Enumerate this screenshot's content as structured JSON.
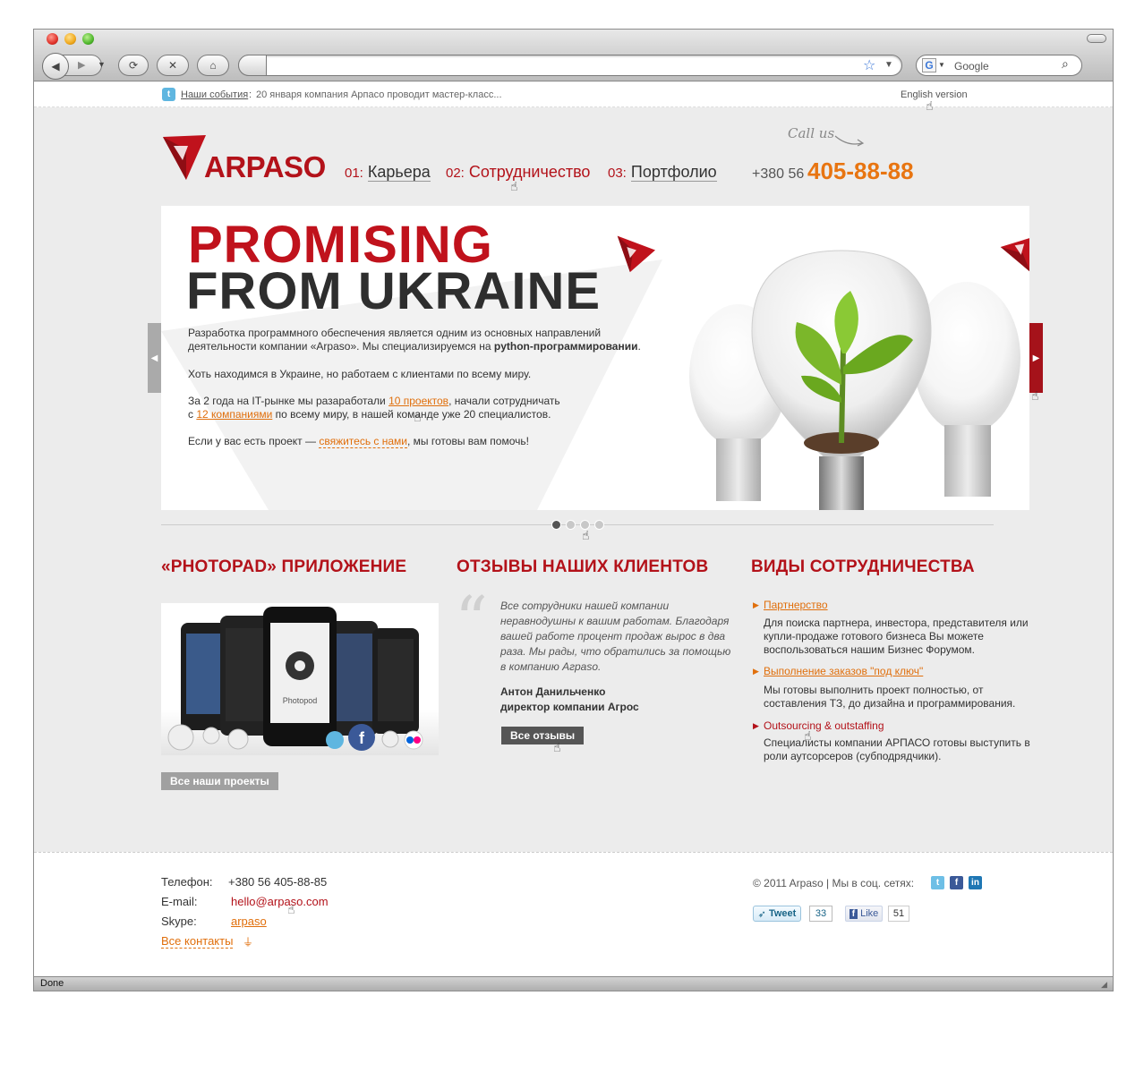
{
  "browser": {
    "search_placeholder": "Google",
    "status_text": "Done"
  },
  "topbar": {
    "news_label": "Наши события",
    "news_text": "20 января компания Арпасо проводит мастер-класс...",
    "english_link": "English version"
  },
  "header": {
    "logo_text": "ARPASO",
    "nav": [
      {
        "num": "01:",
        "label": "Карьера"
      },
      {
        "num": "02:",
        "label": "Сотрудничество"
      },
      {
        "num": "03:",
        "label": "Портфолио"
      }
    ],
    "call_us": "Call us",
    "phone_prefix": "+380 56",
    "phone_number": "405-88-88"
  },
  "banner": {
    "title_line1": "PROMISING",
    "title_line2": "FROM UKRAINE",
    "p1_a": "Разработка программного обеспечения является одним из основных направлений деятельности компании «Arpaso». Мы специализируемся на ",
    "p1_b": "python-программировании",
    "p1_c": ".",
    "p2": "Хоть находимся в Украине, но работаем с клиентами по всему миру.",
    "p3_a": "За 2 года на IT-рынке мы разаработали ",
    "p3_link1": "10 проектов",
    "p3_b": ", начали сотрудничать",
    "p3_c": "с ",
    "p3_link2": "12 компаниями",
    "p3_d": " по всему миру, в нашей команде уже 20 специалистов.",
    "p4_a": "Если у вас есть проект — ",
    "p4_link": "свяжитесь с нами",
    "p4_b": ", мы готовы вам помочь!",
    "slides": 4,
    "active_slide": 1
  },
  "photopad": {
    "heading": "«PHOTOPAD» ПРИЛОЖЕНИЕ",
    "phone_app_name": "Photopod",
    "button": "Все наши проекты"
  },
  "reviews": {
    "heading": "ОТЗЫВЫ НАШИХ КЛИЕНТОВ",
    "quote": "Все сотрудники нашей компании неравнодушны к вашим работам. Благодаря вашей работе процент продаж вырос в два раза. Мы рады, что обратились за помощью в компанию Агрaso.",
    "author_name": "Антон Данильченко",
    "author_title": "директор компании Агрос",
    "button": "Все отзывы"
  },
  "cooperation": {
    "heading": "ВИДЫ СОТРУДНИЧЕСТВА",
    "items": [
      {
        "title": "Партнерство",
        "desc": "Для поиска партнера, инвестора, представителя или купли-продаже готового бизнеса Вы можете воспользоваться нашим Бизнес Форумом."
      },
      {
        "title": "Выполнение заказов \"под ключ\"",
        "desc": "Мы готовы выполнить проект полностью, от составления ТЗ, до дизайна и программирования."
      },
      {
        "title": "Outsourcing & outstaffing",
        "desc": "Специалисты компании АРПАСО готовы выступить в роли аутсорсеров (субподрядчики)."
      }
    ]
  },
  "footer": {
    "phone_label": "Телефон:",
    "phone_value": "+380 56 405-88-85",
    "email_label": "E-mail:",
    "email_value": "hello@arpaso.com",
    "skype_label": "Skype:",
    "skype_value": "arpaso",
    "all_contacts": "Все контакты",
    "copyright": "© 2011 Arpaso  |  Мы в соц. сетях:",
    "tweet_label": "Tweet",
    "tweet_count": "33",
    "like_label": "Like",
    "like_count": "51"
  },
  "colors": {
    "brand_red": "#b3121a",
    "accent_orange": "#e87511"
  }
}
